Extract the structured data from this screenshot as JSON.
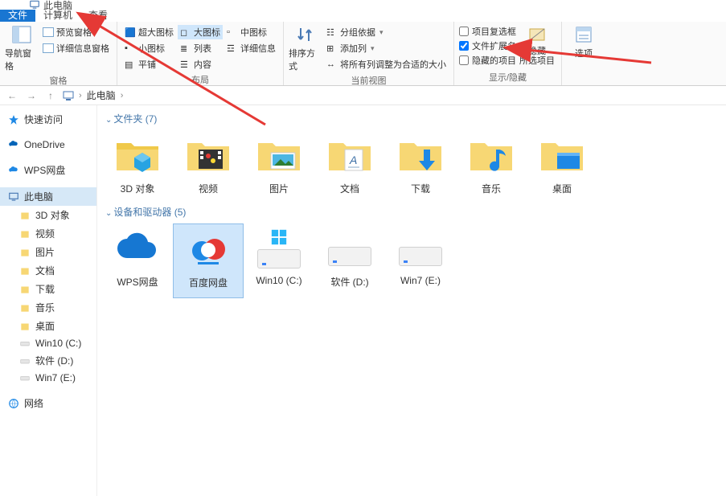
{
  "window": {
    "title": "此电脑"
  },
  "tabs": {
    "file": "文件",
    "computer": "计算机",
    "view": "查看"
  },
  "ribbon": {
    "navPane": "导航窗格",
    "previewPane": "预览窗格",
    "detailsPane": "详细信息窗格",
    "groupPane": "窗格",
    "layout": {
      "xl": "超大图标",
      "l": "大图标",
      "m": "中图标",
      "s": "小图标",
      "list": "列表",
      "details": "详细信息",
      "tiles": "平铺",
      "content": "内容",
      "group": "布局"
    },
    "view": {
      "sort": "排序方式",
      "groupby": "分组依据",
      "addcol": "添加列",
      "fit": "将所有列调整为合适的大小",
      "group": "当前视图"
    },
    "show": {
      "itemcheck": "项目复选框",
      "ext": "文件扩展名",
      "hidden": "隐藏的项目",
      "hide": "隐藏\n所选项目",
      "group": "显示/隐藏"
    },
    "options": "选项"
  },
  "path": {
    "location": "此电脑"
  },
  "sidebar": {
    "quick": "快速访问",
    "onedrive": "OneDrive",
    "wps": "WPS网盘",
    "thispc": "此电脑",
    "tree": {
      "obj3d": "3D 对象",
      "videos": "视频",
      "pictures": "图片",
      "docs": "文档",
      "downloads": "下载",
      "music": "音乐",
      "desktop": "桌面",
      "c": "Win10 (C:)",
      "d": "软件 (D:)",
      "e": "Win7 (E:)"
    },
    "network": "网络"
  },
  "sections": {
    "folders": "文件夹 (7)",
    "drives": "设备和驱动器 (5)"
  },
  "folders": {
    "obj3d": "3D 对象",
    "videos": "视频",
    "pictures": "图片",
    "docs": "文档",
    "downloads": "下载",
    "music": "音乐",
    "desktop": "桌面"
  },
  "drives": {
    "wps": "WPS网盘",
    "baidu": "百度网盘",
    "c": "Win10 (C:)",
    "d": "软件 (D:)",
    "e": "Win7 (E:)"
  }
}
